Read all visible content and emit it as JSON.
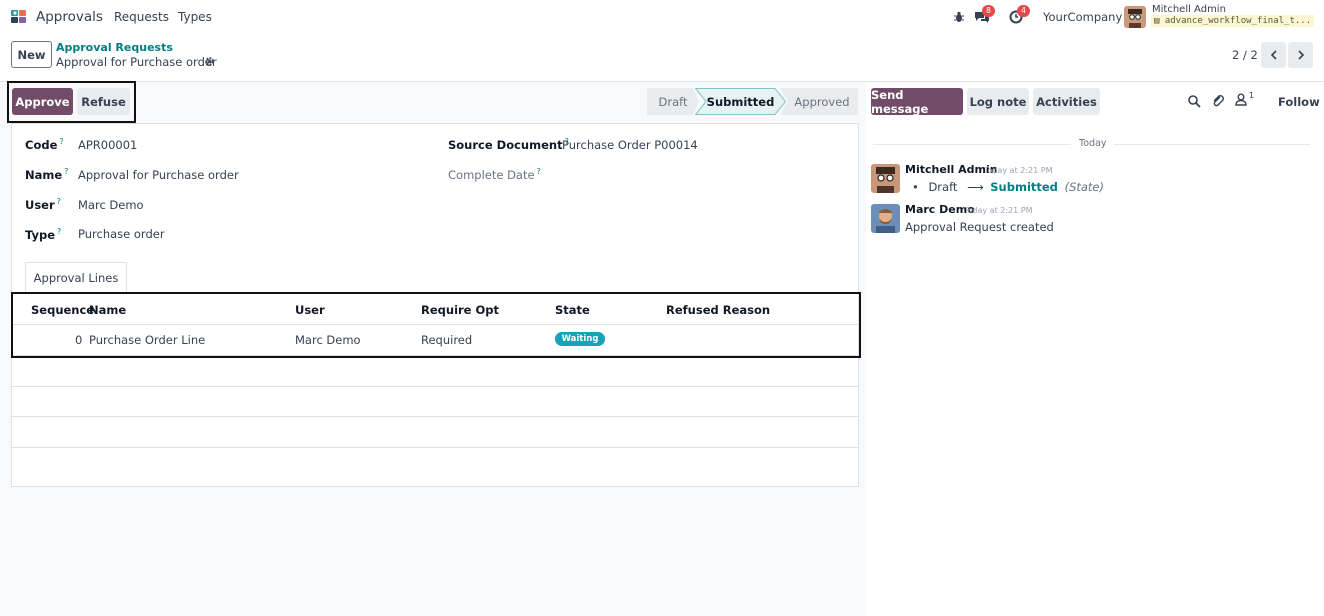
{
  "navbar": {
    "app_name": "Approvals",
    "menu": [
      "Requests",
      "Types"
    ],
    "messages_count": "8",
    "activities_count": "4",
    "company": "YourCompany",
    "user_name": "Mitchell Admin",
    "database": "advance_workflow_final_t..."
  },
  "control_panel": {
    "new_label": "New",
    "breadcrumb_parent": "Approval Requests",
    "breadcrumb_current": "Approval for Purchase order",
    "pager": "2 / 2"
  },
  "header": {
    "approve_label": "Approve",
    "refuse_label": "Refuse",
    "statuses": [
      "Draft",
      "Submitted",
      "Approved"
    ],
    "active_status": "Submitted"
  },
  "form": {
    "code_label": "Code",
    "code_value": "APR00001",
    "name_label": "Name",
    "name_value": "Approval for Purchase order",
    "user_label": "User",
    "user_value": "Marc Demo",
    "type_label": "Type",
    "type_value": "Purchase order",
    "source_label": "Source Document",
    "source_value": "Purchase Order P00014",
    "complete_label": "Complete Date",
    "help_mark": "?"
  },
  "tab": {
    "label": "Approval Lines"
  },
  "table": {
    "columns": [
      "Sequence",
      "Name",
      "User",
      "Require Opt",
      "State",
      "Refused Reason"
    ],
    "rows": [
      {
        "sequence": "0",
        "name": "Purchase Order Line",
        "user": "Marc Demo",
        "require": "Required",
        "state": "Waiting",
        "reason": ""
      }
    ]
  },
  "chatter": {
    "send_label": "Send message",
    "log_label": "Log note",
    "activities_label": "Activities",
    "followers_count": "1",
    "follow_label": "Follow",
    "date_separator": "Today",
    "messages": [
      {
        "author": "Mitchell Admin",
        "time": "Today at 2:21 PM",
        "from": "Draft",
        "to": "Submitted",
        "field": "(State)"
      },
      {
        "author": "Marc Demo",
        "time": "Today at 2:21 PM",
        "body": "Approval Request created"
      }
    ]
  },
  "colors": {
    "primary": "#714b67",
    "link": "#017e84",
    "badge": "#17a2b8"
  }
}
